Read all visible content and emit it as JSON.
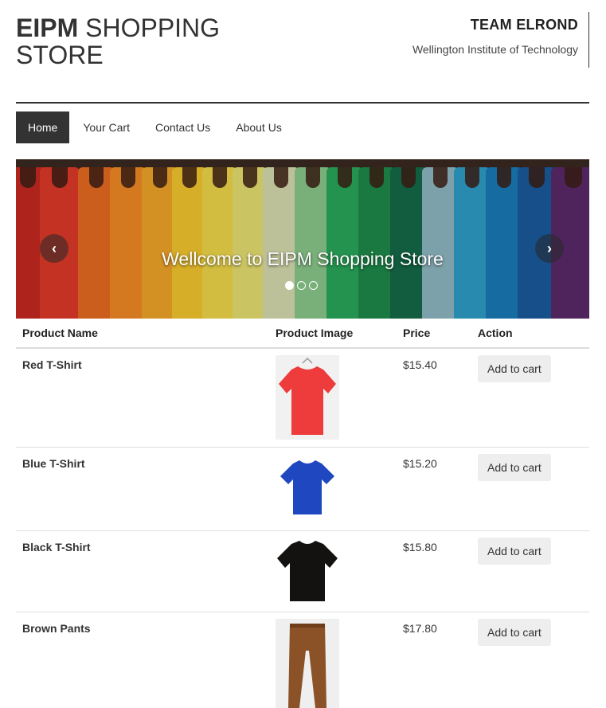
{
  "header": {
    "brand_bold": "EIPM",
    "brand_line1": " SHOPPING",
    "brand_line2": "STORE",
    "team_name": "TEAM ELROND",
    "institute": "Wellington Institute of Technology"
  },
  "nav": {
    "items": [
      {
        "label": "Home",
        "active": true
      },
      {
        "label": "Your Cart",
        "active": false
      },
      {
        "label": "Contact Us",
        "active": false
      },
      {
        "label": "About Us",
        "active": false
      }
    ]
  },
  "carousel": {
    "caption": "Wellcome to EIPM Shopping Store",
    "prev_icon": "chevron-left-icon",
    "next_icon": "chevron-right-icon",
    "slide_count": 3,
    "active_slide": 1
  },
  "table": {
    "headers": [
      "Product Name",
      "Product Image",
      "Price",
      "Action"
    ],
    "rows": [
      {
        "name": "Red T-Shirt",
        "price": "$15.40",
        "action": "Add to cart",
        "color": "#ee3b3b"
      },
      {
        "name": "Blue T-Shirt",
        "price": "$15.20",
        "action": "Add to cart",
        "color": "#1f48c0"
      },
      {
        "name": "Black T-Shirt",
        "price": "$15.80",
        "action": "Add to cart",
        "color": "#141210"
      },
      {
        "name": "Brown Pants",
        "price": "$17.80",
        "action": "Add to cart",
        "color": "#8a5226"
      }
    ]
  },
  "colors": {
    "nav_active_bg": "#333333",
    "button_bg": "#eeeeee",
    "text": "#333333"
  }
}
